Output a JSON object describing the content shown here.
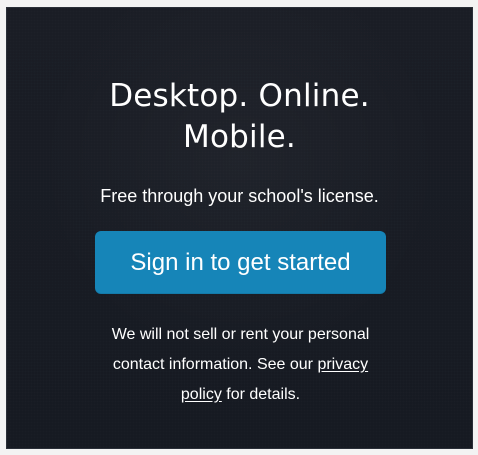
{
  "hero": {
    "title_line_1": "Desktop. Online.",
    "title_line_2": "Mobile.",
    "subtitle": "Free through your school's license.",
    "cta_label": "Sign in to get started"
  },
  "privacy_notice": {
    "line_1": "We will not sell or rent your personal",
    "line_2_before_link": "contact information. See our ",
    "link_part_1": "privacy",
    "link_part_2": "policy",
    "line_3_after_link": " for details."
  },
  "colors": {
    "panel_background": "#1a1d25",
    "button_background": "#1685b8",
    "text": "#ffffff",
    "outer_background": "#f3f3f3"
  }
}
